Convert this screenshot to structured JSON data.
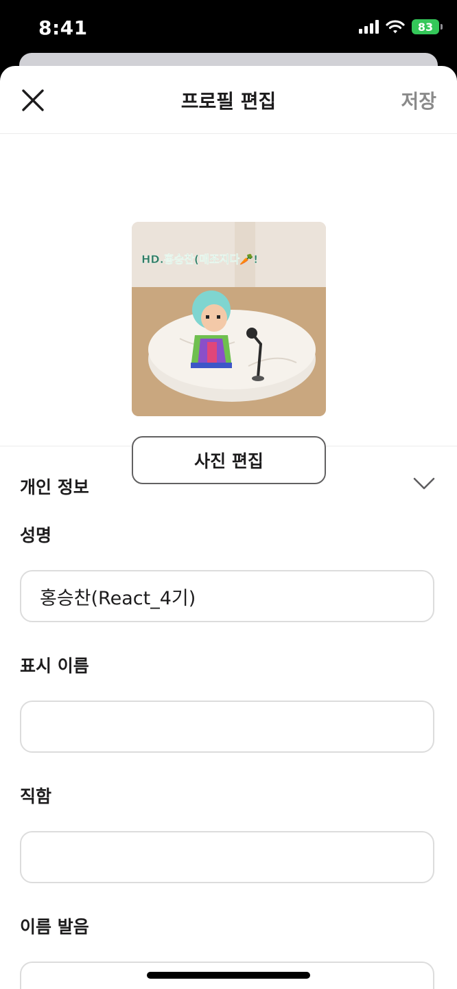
{
  "status_bar": {
    "time": "8:41",
    "battery": "83",
    "icons": [
      "signal-icon",
      "wifi-icon",
      "battery-charging-icon"
    ]
  },
  "nav": {
    "close_icon": "close-icon",
    "title": "프로필 편집",
    "save_label": "저장"
  },
  "profile_photo": {
    "overlay_text": "HD.홍승찬(매조지다🥕!",
    "edit_label": "사진 편집"
  },
  "personal_info": {
    "section_label": "개인 정보",
    "toggle_icon": "chevron-down-icon",
    "fields": [
      {
        "label": "성명",
        "value": "홍승찬(React_4기)"
      },
      {
        "label": "표시 이름",
        "value": ""
      },
      {
        "label": "직함",
        "value": ""
      },
      {
        "label": "이름 발음",
        "value": ""
      }
    ]
  },
  "colors": {
    "accent_text": "#1d1c1d",
    "muted_text": "#8a8a8a",
    "battery": "#34c759"
  }
}
